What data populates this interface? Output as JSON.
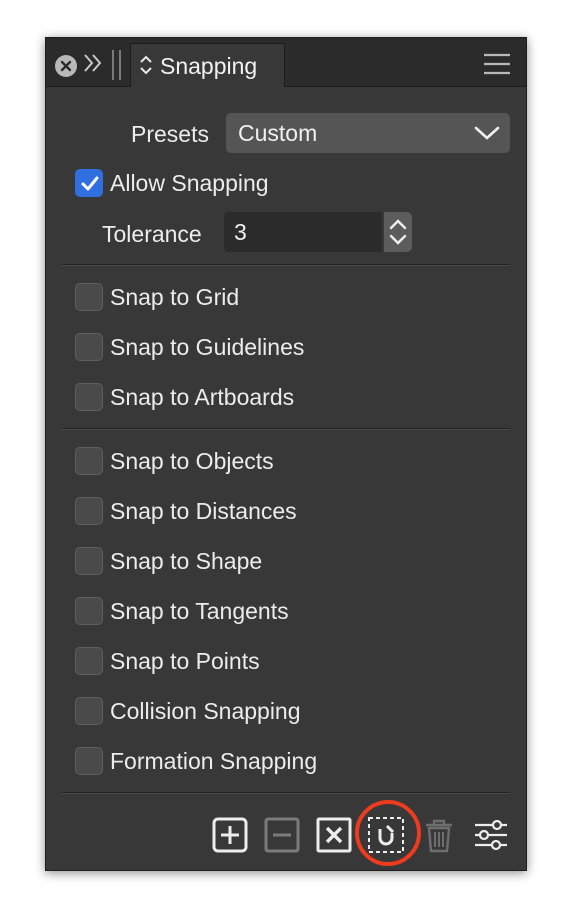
{
  "panel": {
    "tab_title": "Snapping"
  },
  "presets": {
    "label": "Presets",
    "value": "Custom"
  },
  "allow_snapping": {
    "label": "Allow Snapping",
    "checked": true
  },
  "tolerance": {
    "label": "Tolerance",
    "value": "3"
  },
  "snap_options": [
    {
      "label": "Snap to Grid",
      "checked": false
    },
    {
      "label": "Snap to Guidelines",
      "checked": false
    },
    {
      "label": "Snap to Artboards",
      "checked": false
    },
    {
      "label": "Snap to Objects",
      "checked": false
    },
    {
      "label": "Snap to Distances",
      "checked": false
    },
    {
      "label": "Snap to Shape",
      "checked": false
    },
    {
      "label": "Snap to Tangents",
      "checked": false
    },
    {
      "label": "Snap to Points",
      "checked": false
    },
    {
      "label": "Collision Snapping",
      "checked": false
    },
    {
      "label": "Formation Snapping",
      "checked": false
    }
  ],
  "toolbar": {
    "icons": [
      "add-preset-icon",
      "remove-preset-icon",
      "clear-preset-icon",
      "snap-candidates-icon",
      "trash-icon",
      "settings-sliders-icon"
    ],
    "highlighted_tool": "snap-candidates-icon"
  },
  "colors": {
    "panel_bg": "#383838",
    "checkbox_checked": "#2f6fe0",
    "highlight_ring": "#ee3a1f"
  }
}
